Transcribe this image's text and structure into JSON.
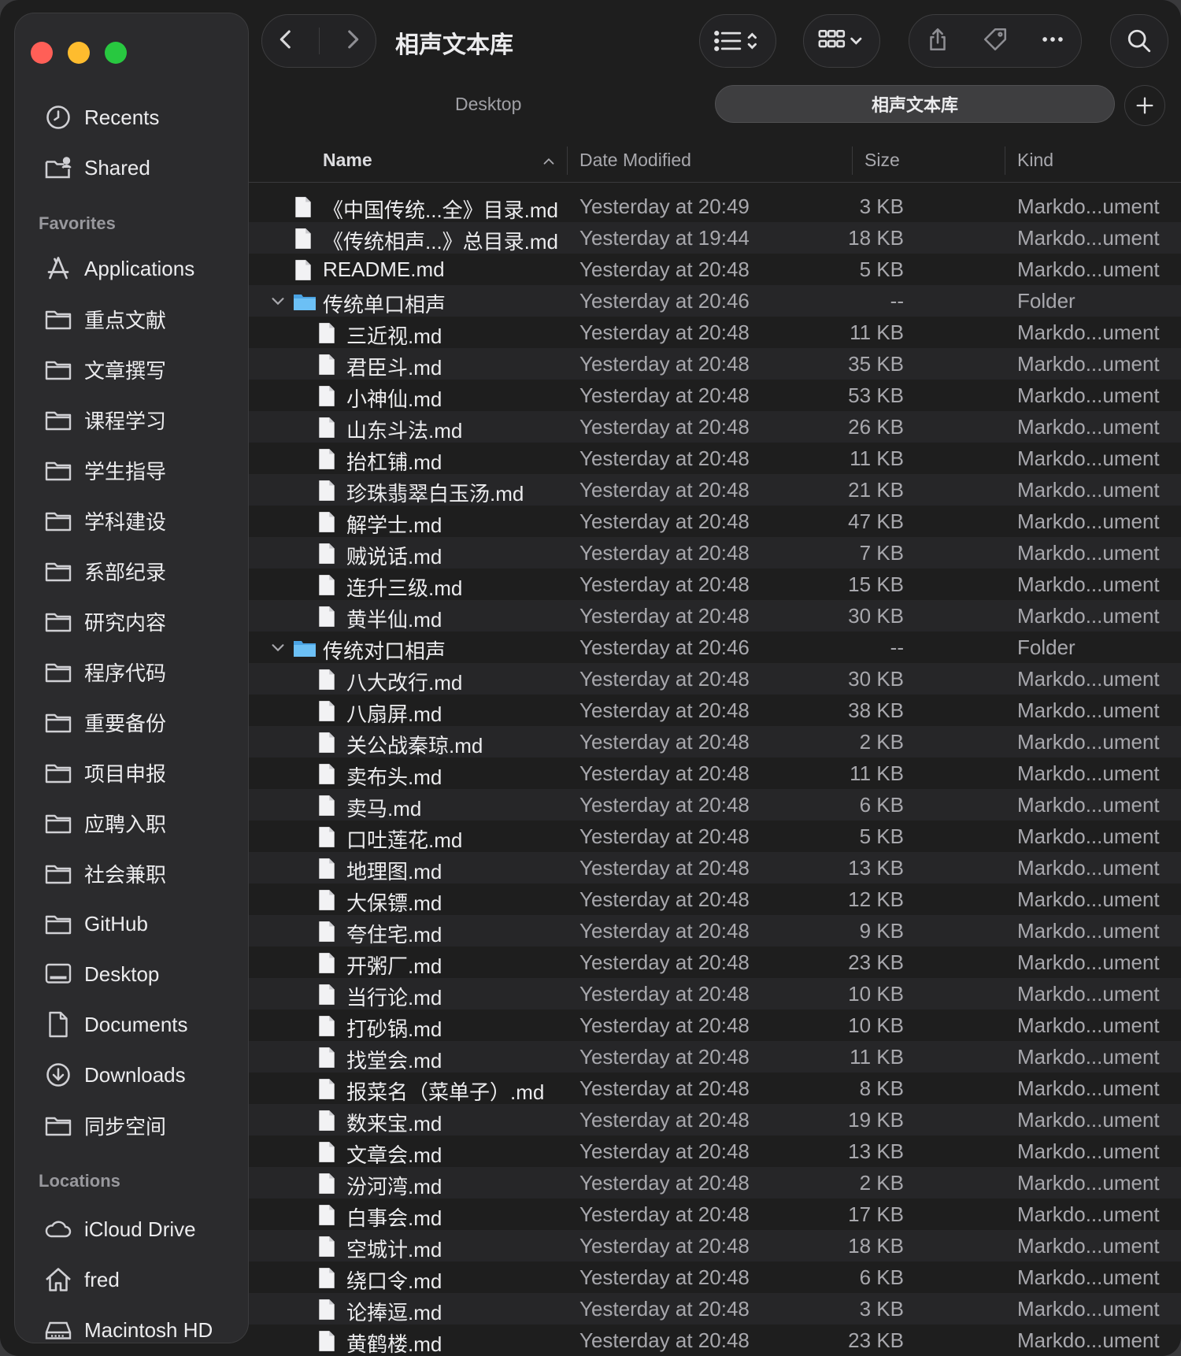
{
  "window": {
    "title": "相声文本库"
  },
  "pathbar": {
    "parent": "Desktop",
    "current": "相声文本库"
  },
  "sidebar": {
    "top_items": [
      {
        "label": "Recents",
        "icon": "clock-icon"
      },
      {
        "label": "Shared",
        "icon": "shared-folder-icon"
      }
    ],
    "favorites_title": "Favorites",
    "favorites": [
      {
        "label": "Applications",
        "icon": "applications-icon"
      },
      {
        "label": "重点文献",
        "icon": "folder-icon"
      },
      {
        "label": "文章撰写",
        "icon": "folder-icon"
      },
      {
        "label": "课程学习",
        "icon": "folder-icon"
      },
      {
        "label": "学生指导",
        "icon": "folder-icon"
      },
      {
        "label": "学科建设",
        "icon": "folder-icon"
      },
      {
        "label": "系部纪录",
        "icon": "folder-icon"
      },
      {
        "label": "研究内容",
        "icon": "folder-icon"
      },
      {
        "label": "程序代码",
        "icon": "folder-icon"
      },
      {
        "label": "重要备份",
        "icon": "folder-icon"
      },
      {
        "label": "项目申报",
        "icon": "folder-icon"
      },
      {
        "label": "应聘入职",
        "icon": "folder-icon"
      },
      {
        "label": "社会兼职",
        "icon": "folder-icon"
      },
      {
        "label": "GitHub",
        "icon": "folder-icon"
      },
      {
        "label": "Desktop",
        "icon": "desktop-icon"
      },
      {
        "label": "Documents",
        "icon": "document-icon"
      },
      {
        "label": "Downloads",
        "icon": "download-icon"
      },
      {
        "label": "同步空间",
        "icon": "folder-icon"
      }
    ],
    "locations_title": "Locations",
    "locations": [
      {
        "label": "iCloud Drive",
        "icon": "cloud-icon"
      },
      {
        "label": "fred",
        "icon": "home-icon"
      },
      {
        "label": "Macintosh HD",
        "icon": "disk-icon"
      }
    ]
  },
  "columns": {
    "name": "Name",
    "date": "Date Modified",
    "size": "Size",
    "kind": "Kind"
  },
  "files": [
    {
      "name": "《中国传统...全》目录.md",
      "date": "Yesterday at 20:49",
      "size": "3 KB",
      "kind": "Markdo...ument",
      "level": 0,
      "type": "file"
    },
    {
      "name": "《传统相声...》总目录.md",
      "date": "Yesterday at 19:44",
      "size": "18 KB",
      "kind": "Markdo...ument",
      "level": 0,
      "type": "file"
    },
    {
      "name": "README.md",
      "date": "Yesterday at 20:48",
      "size": "5 KB",
      "kind": "Markdo...ument",
      "level": 0,
      "type": "file"
    },
    {
      "name": "传统单口相声",
      "date": "Yesterday at 20:46",
      "size": "--",
      "kind": "Folder",
      "level": 0,
      "type": "folder"
    },
    {
      "name": "三近视.md",
      "date": "Yesterday at 20:48",
      "size": "11 KB",
      "kind": "Markdo...ument",
      "level": 1,
      "type": "file"
    },
    {
      "name": "君臣斗.md",
      "date": "Yesterday at 20:48",
      "size": "35 KB",
      "kind": "Markdo...ument",
      "level": 1,
      "type": "file"
    },
    {
      "name": "小神仙.md",
      "date": "Yesterday at 20:48",
      "size": "53 KB",
      "kind": "Markdo...ument",
      "level": 1,
      "type": "file"
    },
    {
      "name": "山东斗法.md",
      "date": "Yesterday at 20:48",
      "size": "26 KB",
      "kind": "Markdo...ument",
      "level": 1,
      "type": "file"
    },
    {
      "name": "抬杠铺.md",
      "date": "Yesterday at 20:48",
      "size": "11 KB",
      "kind": "Markdo...ument",
      "level": 1,
      "type": "file"
    },
    {
      "name": "珍珠翡翠白玉汤.md",
      "date": "Yesterday at 20:48",
      "size": "21 KB",
      "kind": "Markdo...ument",
      "level": 1,
      "type": "file"
    },
    {
      "name": "解学士.md",
      "date": "Yesterday at 20:48",
      "size": "47 KB",
      "kind": "Markdo...ument",
      "level": 1,
      "type": "file"
    },
    {
      "name": "贼说话.md",
      "date": "Yesterday at 20:48",
      "size": "7 KB",
      "kind": "Markdo...ument",
      "level": 1,
      "type": "file"
    },
    {
      "name": "连升三级.md",
      "date": "Yesterday at 20:48",
      "size": "15 KB",
      "kind": "Markdo...ument",
      "level": 1,
      "type": "file"
    },
    {
      "name": "黄半仙.md",
      "date": "Yesterday at 20:48",
      "size": "30 KB",
      "kind": "Markdo...ument",
      "level": 1,
      "type": "file"
    },
    {
      "name": "传统对口相声",
      "date": "Yesterday at 20:46",
      "size": "--",
      "kind": "Folder",
      "level": 0,
      "type": "folder"
    },
    {
      "name": "八大改行.md",
      "date": "Yesterday at 20:48",
      "size": "30 KB",
      "kind": "Markdo...ument",
      "level": 1,
      "type": "file"
    },
    {
      "name": "八扇屏.md",
      "date": "Yesterday at 20:48",
      "size": "38 KB",
      "kind": "Markdo...ument",
      "level": 1,
      "type": "file"
    },
    {
      "name": "关公战秦琼.md",
      "date": "Yesterday at 20:48",
      "size": "2 KB",
      "kind": "Markdo...ument",
      "level": 1,
      "type": "file"
    },
    {
      "name": "卖布头.md",
      "date": "Yesterday at 20:48",
      "size": "11 KB",
      "kind": "Markdo...ument",
      "level": 1,
      "type": "file"
    },
    {
      "name": "卖马.md",
      "date": "Yesterday at 20:48",
      "size": "6 KB",
      "kind": "Markdo...ument",
      "level": 1,
      "type": "file"
    },
    {
      "name": "口吐莲花.md",
      "date": "Yesterday at 20:48",
      "size": "5 KB",
      "kind": "Markdo...ument",
      "level": 1,
      "type": "file"
    },
    {
      "name": "地理图.md",
      "date": "Yesterday at 20:48",
      "size": "13 KB",
      "kind": "Markdo...ument",
      "level": 1,
      "type": "file"
    },
    {
      "name": "大保镖.md",
      "date": "Yesterday at 20:48",
      "size": "12 KB",
      "kind": "Markdo...ument",
      "level": 1,
      "type": "file"
    },
    {
      "name": "夸住宅.md",
      "date": "Yesterday at 20:48",
      "size": "9 KB",
      "kind": "Markdo...ument",
      "level": 1,
      "type": "file"
    },
    {
      "name": "开粥厂.md",
      "date": "Yesterday at 20:48",
      "size": "23 KB",
      "kind": "Markdo...ument",
      "level": 1,
      "type": "file"
    },
    {
      "name": "当行论.md",
      "date": "Yesterday at 20:48",
      "size": "10 KB",
      "kind": "Markdo...ument",
      "level": 1,
      "type": "file"
    },
    {
      "name": "打砂锅.md",
      "date": "Yesterday at 20:48",
      "size": "10 KB",
      "kind": "Markdo...ument",
      "level": 1,
      "type": "file"
    },
    {
      "name": "找堂会.md",
      "date": "Yesterday at 20:48",
      "size": "11 KB",
      "kind": "Markdo...ument",
      "level": 1,
      "type": "file"
    },
    {
      "name": "报菜名（菜单子）.md",
      "date": "Yesterday at 20:48",
      "size": "8 KB",
      "kind": "Markdo...ument",
      "level": 1,
      "type": "file"
    },
    {
      "name": "数来宝.md",
      "date": "Yesterday at 20:48",
      "size": "19 KB",
      "kind": "Markdo...ument",
      "level": 1,
      "type": "file"
    },
    {
      "name": "文章会.md",
      "date": "Yesterday at 20:48",
      "size": "13 KB",
      "kind": "Markdo...ument",
      "level": 1,
      "type": "file"
    },
    {
      "name": "汾河湾.md",
      "date": "Yesterday at 20:48",
      "size": "2 KB",
      "kind": "Markdo...ument",
      "level": 1,
      "type": "file"
    },
    {
      "name": "白事会.md",
      "date": "Yesterday at 20:48",
      "size": "17 KB",
      "kind": "Markdo...ument",
      "level": 1,
      "type": "file"
    },
    {
      "name": "空城计.md",
      "date": "Yesterday at 20:48",
      "size": "18 KB",
      "kind": "Markdo...ument",
      "level": 1,
      "type": "file"
    },
    {
      "name": "绕口令.md",
      "date": "Yesterday at 20:48",
      "size": "6 KB",
      "kind": "Markdo...ument",
      "level": 1,
      "type": "file"
    },
    {
      "name": "论捧逗.md",
      "date": "Yesterday at 20:48",
      "size": "3 KB",
      "kind": "Markdo...ument",
      "level": 1,
      "type": "file"
    },
    {
      "name": "黄鹤楼.md",
      "date": "Yesterday at 20:48",
      "size": "23 KB",
      "kind": "Markdo...ument",
      "level": 1,
      "type": "file"
    }
  ],
  "colors": {
    "accent_folder": "#5ab1ef",
    "close": "#ff5f57",
    "minimize": "#febc2e",
    "maximize": "#28c840"
  }
}
